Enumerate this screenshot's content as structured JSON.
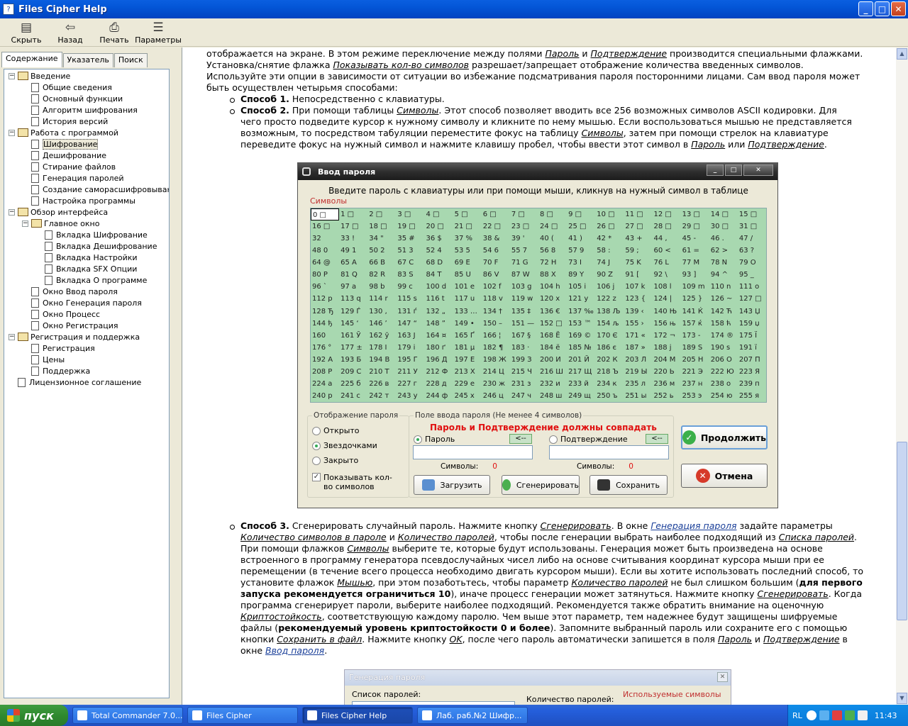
{
  "window": {
    "title": "Files Cipher Help"
  },
  "toolbar": {
    "hide": "Скрыть",
    "back": "Назад",
    "print": "Печать",
    "options": "Параметры"
  },
  "tabs": {
    "contents": "Содержание",
    "index": "Указатель",
    "search": "Поиск"
  },
  "tree": [
    {
      "label": "Введение",
      "kind": "book",
      "level": 0,
      "pm": "−"
    },
    {
      "label": "Общие сведения",
      "kind": "page",
      "level": 1
    },
    {
      "label": "Основный функции",
      "kind": "page",
      "level": 1
    },
    {
      "label": "Алгоритм шифрования",
      "kind": "page",
      "level": 1
    },
    {
      "label": "История версий",
      "kind": "page",
      "level": 1
    },
    {
      "label": "Работа с программой",
      "kind": "book",
      "level": 0,
      "pm": "−"
    },
    {
      "label": "Шифрование",
      "kind": "page",
      "level": 1,
      "selected": true
    },
    {
      "label": "Дешифрование",
      "kind": "page",
      "level": 1
    },
    {
      "label": "Стирание файлов",
      "kind": "page",
      "level": 1
    },
    {
      "label": "Генерация паролей",
      "kind": "page",
      "level": 1
    },
    {
      "label": "Создание саморасшифровываю",
      "kind": "page",
      "level": 1
    },
    {
      "label": "Настройка программы",
      "kind": "page",
      "level": 1
    },
    {
      "label": "Обзор интерфейса",
      "kind": "book",
      "level": 0,
      "pm": "−"
    },
    {
      "label": "Главное окно",
      "kind": "book",
      "level": 1,
      "pm": "−"
    },
    {
      "label": "Вкладка Шифрование",
      "kind": "page",
      "level": 2
    },
    {
      "label": "Вкладка Дешифрование",
      "kind": "page",
      "level": 2
    },
    {
      "label": "Вкладка Настройки",
      "kind": "page",
      "level": 2
    },
    {
      "label": "Вкладка SFX Опции",
      "kind": "page",
      "level": 2
    },
    {
      "label": "Вкладка О программе",
      "kind": "page",
      "level": 2
    },
    {
      "label": "Окно Ввод пароля",
      "kind": "page",
      "level": 1
    },
    {
      "label": "Окно Генерация пароля",
      "kind": "page",
      "level": 1
    },
    {
      "label": "Окно Процесс",
      "kind": "page",
      "level": 1
    },
    {
      "label": "Окно Регистрация",
      "kind": "page",
      "level": 1
    },
    {
      "label": "Регистрация и поддержка",
      "kind": "book",
      "level": 0,
      "pm": "−"
    },
    {
      "label": "Регистрация",
      "kind": "page",
      "level": 1
    },
    {
      "label": "Цены",
      "kind": "page",
      "level": 1
    },
    {
      "label": "Поддержка",
      "kind": "page",
      "level": 1
    },
    {
      "label": "Лицензионное соглашение",
      "kind": "page",
      "level": 0
    }
  ],
  "content": {
    "p1_l1": "отображается на экране. В этом режиме переключение между полями <i>Пароль</i> и <i>Подтверждение</i> производится специальными флажками.",
    "p1_l2": "Установка/снятие флажка <i>Показывать кол-во символов</i> разрешает/запрещает отображение количества введенных символов.",
    "p1_l3": "Используйте эти опции в зависимости от ситуации во избежание подсматривания пароля посторонними лицами. Сам ввод пароля может",
    "p1_l4": "быть осуществлен четырьмя способами:",
    "m1": "<b>Способ 1.</b> Непосредственно с клавиатуры.",
    "m2_l1": "<b>Способ 2.</b> При помощи таблицы <i>Символы</i>. Этот способ позволяет вводить все 256 возможных символов ASCII кодировки. Для",
    "m2_l2": "чего просто подведите курсор к нужному символу и кликните по нему мышью. Если воспользоваться мышью не представляется",
    "m2_l3": "возможным, то посредством табуляции переместите фокус на таблицу <i>Символы</i>, затем при помощи стрелок на клавиатуре",
    "m2_l4": "переведите фокус на нужный символ и нажмите клавишу пробел, чтобы ввести этот символ в <i>Пароль</i> или <i>Подтверждение</i>.",
    "m3_l1": "<b>Способ 3.</b> Сгенерировать случайный пароль. Нажмите кнопку <i>Сгенерировать</i>. В окне <i class=\"link\">Генерация пароля</i> задайте параметры",
    "m3_l2": "<i>Количество символов в пароле</i> и <i>Количество паролей</i>, чтобы после генерации выбрать наиболее подходящий из <i>Списка паролей</i>.",
    "m3_l3": "При помощи флажков <i>Символы</i> выберите те, которые будут использованы. Генерация может быть произведена на основе",
    "m3_l4": "встроенного в программу генератора псевдослучайных чисел либо на основе считывания координат курсора мыши при ее",
    "m3_l5": "перемещении (в течение всего процесса необходимо двигать курсором мыши). Если вы хотите использовать последний способ, то",
    "m3_l6": "установите флажок <i>Мышью</i>, при этом позаботьтесь, чтобы параметр <i>Количество паролей</i> не был слишком большим (<b>для первого</b>",
    "m3_l7": "<b>запуска рекомендуется ограничиться 10</b>), иначе процесс генерации может затянуться. Нажмите кнопку <i>Сгенерировать</i>. Когда",
    "m3_l8": "программа сгенерирует пароли, выберите наиболее подходящий. Рекомендуется также обратить внимание на оценочную",
    "m3_l9": "<i>Криптостойкость</i>, соответствующую каждому паролю. Чем выше этот параметр, тем надежнее будут защищены шифруемые",
    "m3_l10": "файлы (<b>рекомендуемый уровень криптостойкости 0 и более</b>). Запомните выбранный пароль или сохраните его с помощью",
    "m3_l11": "кнопки <i>Сохранить в файл</i>. Нажмите кнопку <i>OK</i>, после чего пароль автоматически запишется в поля <i>Пароль</i> и <i>Подтверждение</i> в",
    "m3_l12": "окне <i class=\"link\">Ввод пароля</i>."
  },
  "dialog": {
    "title": "Ввод пароля",
    "hint": "Введите пароль с клавиатуры или при помощи мыши, кликнув на нужный символ в таблице",
    "symbols_label": "Символы",
    "display_group": "Отображение пароля",
    "open": "Открыто",
    "stars": "Звездочками",
    "closed": "Закрыто",
    "show_count": "Показывать кол-во символов",
    "field_group": "Поле ввода пароля (Не менее 4 символов)",
    "warning": "Пароль и Подтверждение должны совпадать",
    "password": "Пароль",
    "confirm": "Подтверждение",
    "arrow": "<--",
    "symbols_count": "Символы:",
    "zero": "0",
    "load": "Загрузить",
    "generate": "Сгенерировать",
    "save": "Сохранить",
    "continue": "Продолжить",
    "cancel": "Отмена",
    "grid": [
      "0 □",
      "1 □",
      "2 □",
      "3 □",
      "4 □",
      "5 □",
      "6 □",
      "7 □",
      "8 □",
      "9 □",
      "10 □",
      "11 □",
      "12 □",
      "13 □",
      "14 □",
      "15 □",
      "16 □",
      "17 □",
      "18 □",
      "19 □",
      "20 □",
      "21 □",
      "22 □",
      "23 □",
      "24 □",
      "25 □",
      "26 □",
      "27 □",
      "28 □",
      "29 □",
      "30 □",
      "31 □",
      "32",
      "33 !",
      "34 \"",
      "35 #",
      "36 $",
      "37 %",
      "38 &",
      "39 '",
      "40 (",
      "41 )",
      "42 *",
      "43 +",
      "44 ,",
      "45 -",
      "46 .",
      "47 /",
      "48 0",
      "49 1",
      "50 2",
      "51 3",
      "52 4",
      "53 5",
      "54 6",
      "55 7",
      "56 8",
      "57 9",
      "58 :",
      "59 ;",
      "60 <",
      "61 =",
      "62 >",
      "63 ?",
      "64 @",
      "65 A",
      "66 B",
      "67 C",
      "68 D",
      "69 E",
      "70 F",
      "71 G",
      "72 H",
      "73 I",
      "74 J",
      "75 K",
      "76 L",
      "77 M",
      "78 N",
      "79 O",
      "80 P",
      "81 Q",
      "82 R",
      "83 S",
      "84 T",
      "85 U",
      "86 V",
      "87 W",
      "88 X",
      "89 Y",
      "90 Z",
      "91 [",
      "92 \\",
      "93 ]",
      "94 ^",
      "95 _",
      "96 `",
      "97 a",
      "98 b",
      "99 c",
      "100 d",
      "101 e",
      "102 f",
      "103 g",
      "104 h",
      "105 i",
      "106 j",
      "107 k",
      "108 l",
      "109 m",
      "110 n",
      "111 o",
      "112 p",
      "113 q",
      "114 r",
      "115 s",
      "116 t",
      "117 u",
      "118 v",
      "119 w",
      "120 x",
      "121 y",
      "122 z",
      "123 {",
      "124 |",
      "125 }",
      "126 ~",
      "127 □",
      "128 Ђ",
      "129 Ѓ",
      "130 ‚",
      "131 ѓ",
      "132 „",
      "133 …",
      "134 †",
      "135 ‡",
      "136 €",
      "137 ‰",
      "138 Љ",
      "139 ‹",
      "140 Њ",
      "141 Ќ",
      "142 Ћ",
      "143 Џ",
      "144 ђ",
      "145 ‘",
      "146 ’",
      "147 “",
      "148 ”",
      "149 •",
      "150 –",
      "151 —",
      "152 □",
      "153 ™",
      "154 љ",
      "155 ›",
      "156 њ",
      "157 ќ",
      "158 ћ",
      "159 џ",
      "160",
      "161 Ў",
      "162 ў",
      "163 Ј",
      "164 ¤",
      "165 Ґ",
      "166 ¦",
      "167 §",
      "168 Ё",
      "169 ©",
      "170 Є",
      "171 «",
      "172 ¬",
      "173 -",
      "174 ®",
      "175 Ї",
      "176 °",
      "177 ±",
      "178 І",
      "179 і",
      "180 ґ",
      "181 µ",
      "182 ¶",
      "183 ·",
      "184 ё",
      "185 №",
      "186 є",
      "187 »",
      "188 ј",
      "189 Ѕ",
      "190 ѕ",
      "191 ї",
      "192 А",
      "193 Б",
      "194 В",
      "195 Г",
      "196 Д",
      "197 Е",
      "198 Ж",
      "199 З",
      "200 И",
      "201 Й",
      "202 К",
      "203 Л",
      "204 М",
      "205 Н",
      "206 О",
      "207 П",
      "208 Р",
      "209 С",
      "210 Т",
      "211 У",
      "212 Ф",
      "213 Х",
      "214 Ц",
      "215 Ч",
      "216 Ш",
      "217 Щ",
      "218 Ъ",
      "219 Ы",
      "220 Ь",
      "221 Э",
      "222 Ю",
      "223 Я",
      "224 а",
      "225 б",
      "226 в",
      "227 г",
      "228 д",
      "229 е",
      "230 ж",
      "231 з",
      "232 и",
      "233 й",
      "234 к",
      "235 л",
      "236 м",
      "237 н",
      "238 о",
      "239 п",
      "240 р",
      "241 с",
      "242 т",
      "243 у",
      "244 ф",
      "245 х",
      "246 ц",
      "247 ч",
      "248 ш",
      "249 щ",
      "250 ъ",
      "251 ы",
      "252 ь",
      "253 э",
      "254 ю",
      "255 я"
    ]
  },
  "dialog2": {
    "title": "Генерация пароля",
    "list": "Список паролей:",
    "count": "Количество паролей:",
    "used": "Используемые символы"
  },
  "taskbar": {
    "start": "пуск",
    "tasks": [
      "Total Commander 7.0...",
      "Files Cipher",
      "Files Cipher Help",
      "Лаб. раб.№2 Шифр..."
    ],
    "lang": "RL",
    "time": "11:43"
  }
}
